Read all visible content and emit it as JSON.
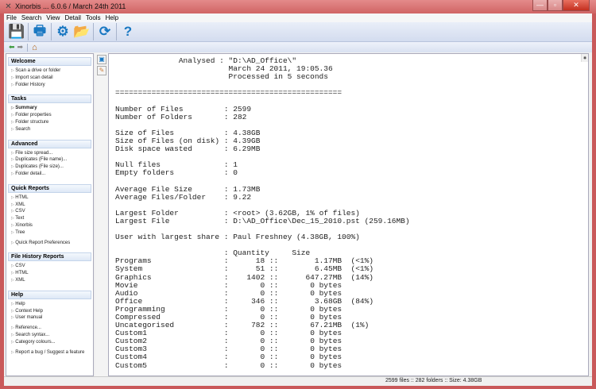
{
  "window": {
    "title": "Xinorbis ... 6.0.6 / March 24th 2011",
    "min": "—",
    "max": "▫",
    "close": "✕"
  },
  "menu": [
    "File",
    "Search",
    "View",
    "Detail",
    "Tools",
    "Help"
  ],
  "toolbar": [
    {
      "name": "save-icon",
      "glyph": "💾"
    },
    {
      "name": "print-icon",
      "glyph": "🖶"
    },
    {
      "name": "settings-icon",
      "glyph": "⚙"
    },
    {
      "name": "folder-open-icon",
      "glyph": "📂"
    },
    {
      "name": "refresh-icon",
      "glyph": "⟳"
    },
    {
      "name": "help-icon",
      "glyph": "?"
    }
  ],
  "nav": {
    "back": "⬅",
    "forward": "➡",
    "home": "⌂"
  },
  "sidebar": [
    {
      "title": "Welcome",
      "items": [
        [
          "Scan a drive or folder",
          "Import scan detail",
          "Folder History"
        ]
      ]
    },
    {
      "title": "Tasks",
      "items": [
        [
          "Summary",
          "Folder properties",
          "Folder structure",
          "Search"
        ]
      ],
      "bold": "Summary"
    },
    {
      "title": "Advanced",
      "items": [
        [
          "File size spread...",
          "Duplicates (File name)...",
          "Duplicates (File size)...",
          "Folder detail..."
        ]
      ]
    },
    {
      "title": "Quick Reports",
      "items": [
        [
          "HTML",
          "XML",
          "CSV",
          "Text",
          "Xinorbis",
          "Tree"
        ],
        [
          "Quick Report Preferences"
        ]
      ]
    },
    {
      "title": "File History Reports",
      "items": [
        [
          "CSV",
          "HTML",
          "XML"
        ]
      ]
    },
    {
      "title": "Help",
      "items": [
        [
          "Help",
          "Context Help",
          "User manual"
        ],
        [
          "Reference...",
          "Search syntax...",
          "Category colours..."
        ],
        [
          "Report a bug / Suggest a feature"
        ]
      ]
    }
  ],
  "report": {
    "analysed_label": "Analysed",
    "path": "\"D:\\AD_Office\\\"",
    "date": "March 24 2011, 19:05.36",
    "processed": "Processed in 5 seconds",
    "separator": "==================================================",
    "stats": [
      [
        [
          "Number of Files",
          "2599"
        ],
        [
          "Number of Folders",
          "282"
        ]
      ],
      [
        [
          "Size of Files",
          "4.38GB"
        ],
        [
          "Size of Files (on disk)",
          "4.39GB"
        ],
        [
          "Disk space wasted",
          "6.29MB"
        ]
      ],
      [
        [
          "Null files",
          "1"
        ],
        [
          "Empty folders",
          "0"
        ]
      ],
      [
        [
          "Average File Size",
          "1.73MB"
        ],
        [
          "Average Files/Folder",
          "9.22"
        ]
      ],
      [
        [
          "Largest Folder",
          "<root> (3.62GB, 1% of files)"
        ],
        [
          "Largest File",
          "D:\\AD_Office\\Dec_15_2010.pst (259.16MB)"
        ]
      ],
      [
        [
          "User with largest share",
          "Paul Freshney (4.38GB, 100%)"
        ]
      ]
    ],
    "headers": {
      "quantity": "Quantity",
      "size": "Size"
    },
    "categories": [
      [
        "Programs",
        "18",
        "1.17MB",
        "(<1%)"
      ],
      [
        "System",
        "51",
        "6.45MB",
        "(<1%)"
      ],
      [
        "Graphics",
        "1402",
        "647.27MB",
        "(14%)"
      ],
      [
        "Movie",
        "0",
        "0 bytes",
        ""
      ],
      [
        "Audio",
        "0",
        "0 bytes",
        ""
      ],
      [
        "Office",
        "346",
        "3.68GB",
        "(84%)"
      ],
      [
        "Programming",
        "0",
        "0 bytes",
        ""
      ],
      [
        "Compressed",
        "0",
        "0 bytes",
        ""
      ],
      [
        "Uncategorised",
        "782",
        "67.21MB",
        "(1%)"
      ],
      [
        "Custom1",
        "0",
        "0 bytes",
        ""
      ],
      [
        "Custom2",
        "0",
        "0 bytes",
        ""
      ],
      [
        "Custom3",
        "0",
        "0 bytes",
        ""
      ],
      [
        "Custom4",
        "0",
        "0 bytes",
        ""
      ],
      [
        "Custom5",
        "0",
        "0 bytes",
        ""
      ]
    ]
  },
  "status": "2599 files  ::  282 folders  ::  Size: 4.38GB"
}
